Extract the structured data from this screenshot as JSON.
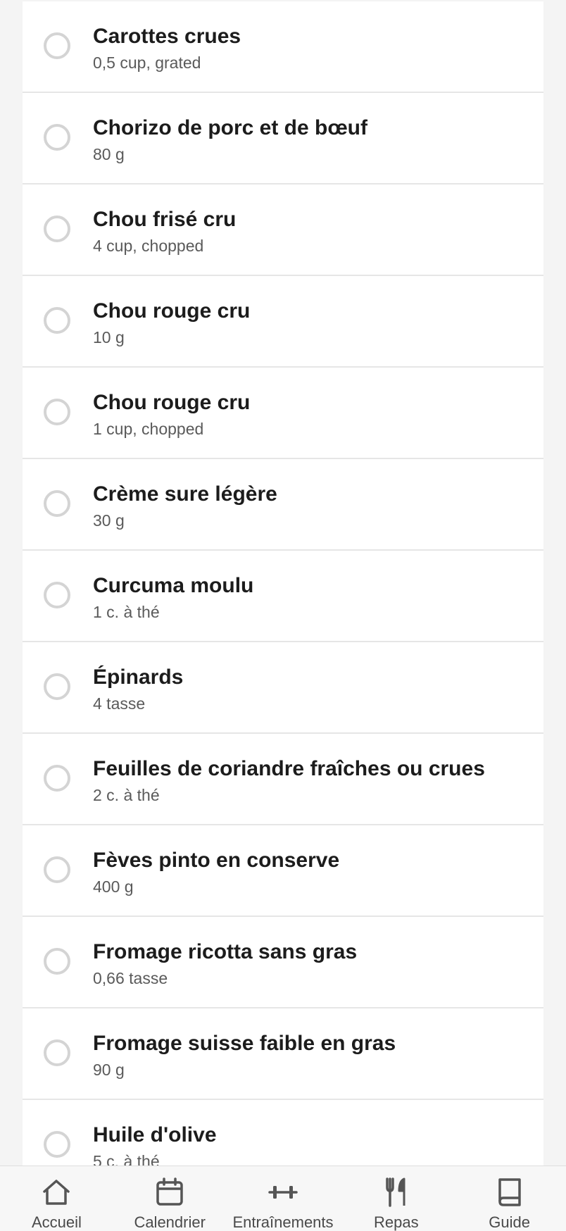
{
  "shopping_list": {
    "items": [
      {
        "name": "Carottes crues",
        "amount": "0,5 cup, grated",
        "checked": false
      },
      {
        "name": "Chorizo de porc et de bœuf",
        "amount": "80 g",
        "checked": false
      },
      {
        "name": "Chou frisé cru",
        "amount": "4 cup, chopped",
        "checked": false
      },
      {
        "name": "Chou rouge cru",
        "amount": "10 g",
        "checked": false
      },
      {
        "name": "Chou rouge cru",
        "amount": "1 cup, chopped",
        "checked": false
      },
      {
        "name": "Crème sure légère",
        "amount": "30 g",
        "checked": false
      },
      {
        "name": "Curcuma moulu",
        "amount": "1 c. à thé",
        "checked": false
      },
      {
        "name": "Épinards",
        "amount": "4 tasse",
        "checked": false
      },
      {
        "name": "Feuilles de coriandre fraîches ou crues",
        "amount": "2 c. à thé",
        "checked": false
      },
      {
        "name": "Fèves pinto en conserve",
        "amount": "400 g",
        "checked": false
      },
      {
        "name": "Fromage ricotta sans gras",
        "amount": "0,66 tasse",
        "checked": false
      },
      {
        "name": "Fromage suisse faible en gras",
        "amount": "90 g",
        "checked": false
      },
      {
        "name": "Huile d'olive",
        "amount": "5 c. à thé",
        "checked": false
      }
    ]
  },
  "tabbar": {
    "tabs": [
      {
        "label": "Accueil",
        "icon": "home-icon"
      },
      {
        "label": "Calendrier",
        "icon": "calendar-icon"
      },
      {
        "label": "Entraînements",
        "icon": "dumbbell-icon"
      },
      {
        "label": "Repas",
        "icon": "fork-knife-icon"
      },
      {
        "label": "Guide",
        "icon": "book-icon"
      }
    ]
  },
  "colors": {
    "background": "#f4f4f4",
    "card": "#ffffff",
    "text": "#1c1c1c",
    "subtext": "#5a5a5a",
    "checkbox_border": "#d4d4d4",
    "icon": "#555555"
  }
}
